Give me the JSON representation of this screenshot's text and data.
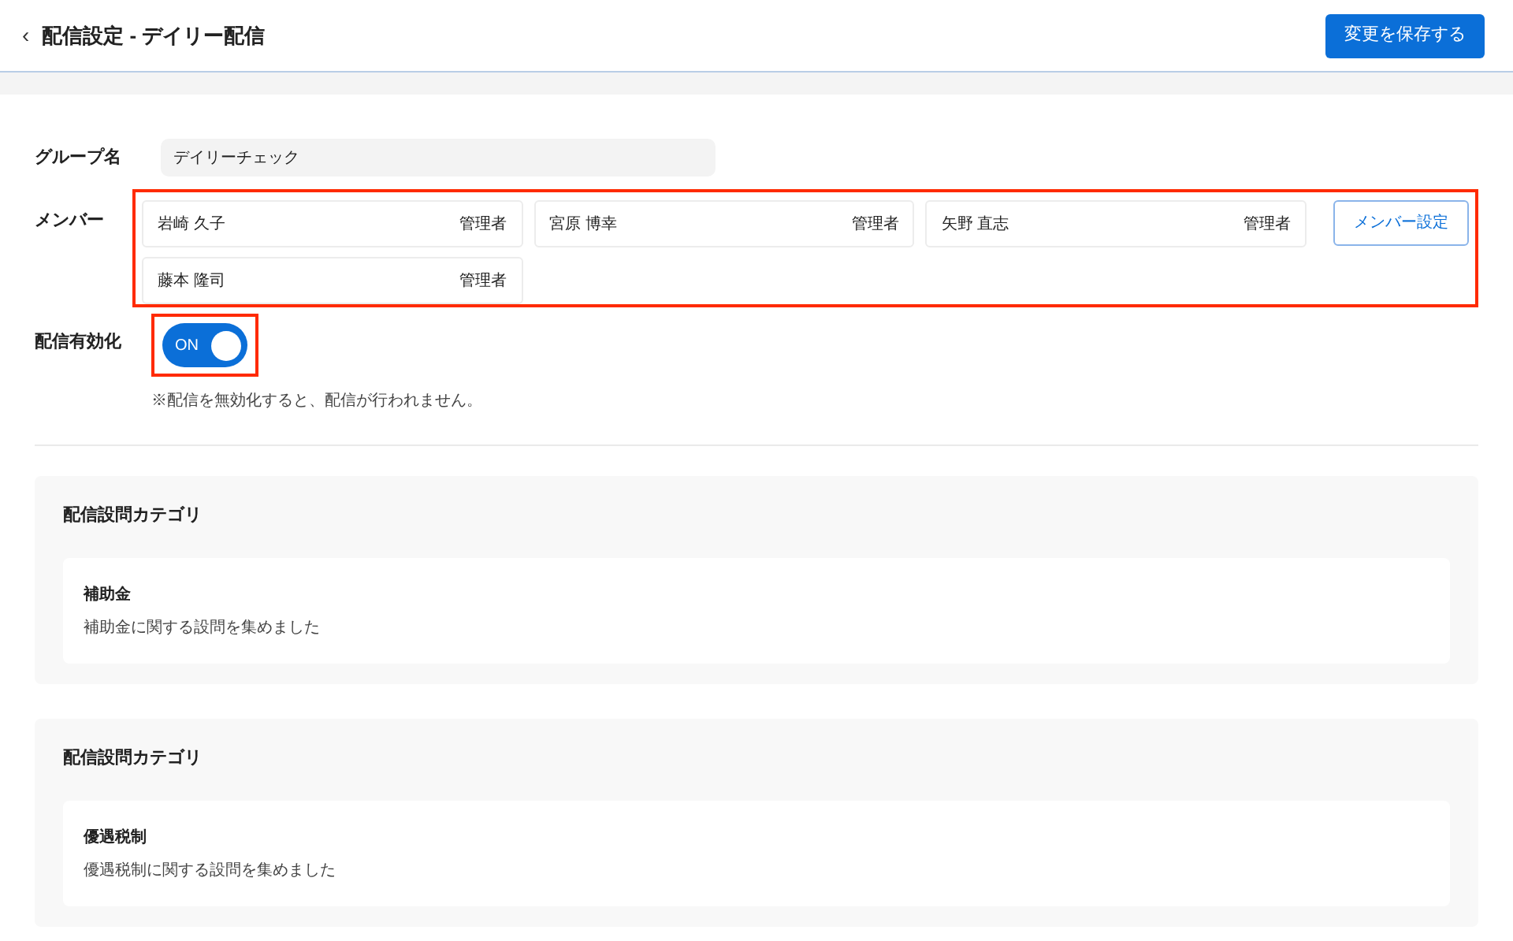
{
  "header": {
    "back_icon": "‹",
    "title": "配信設定 - デイリー配信",
    "save_button": "変更を保存する"
  },
  "group_name": {
    "label": "グループ名",
    "value": "デイリーチェック"
  },
  "members": {
    "label": "メンバー",
    "items": [
      {
        "name": "岩崎 久子",
        "role": "管理者"
      },
      {
        "name": "宮原 博幸",
        "role": "管理者"
      },
      {
        "name": "矢野 直志",
        "role": "管理者"
      },
      {
        "name": "藤本 隆司",
        "role": "管理者"
      }
    ],
    "settings_button": "メンバー設定"
  },
  "delivery": {
    "label": "配信有効化",
    "toggle": {
      "on": true,
      "text": "ON"
    },
    "note": "※配信を無効化すると、配信が行われません。"
  },
  "categories": [
    {
      "heading": "配信設問カテゴリ",
      "title": "補助金",
      "description": "補助金に関する設問を集めました"
    },
    {
      "heading": "配信設問カテゴリ",
      "title": "優遇税制",
      "description": "優遇税制に関する設問を集めました"
    }
  ]
}
